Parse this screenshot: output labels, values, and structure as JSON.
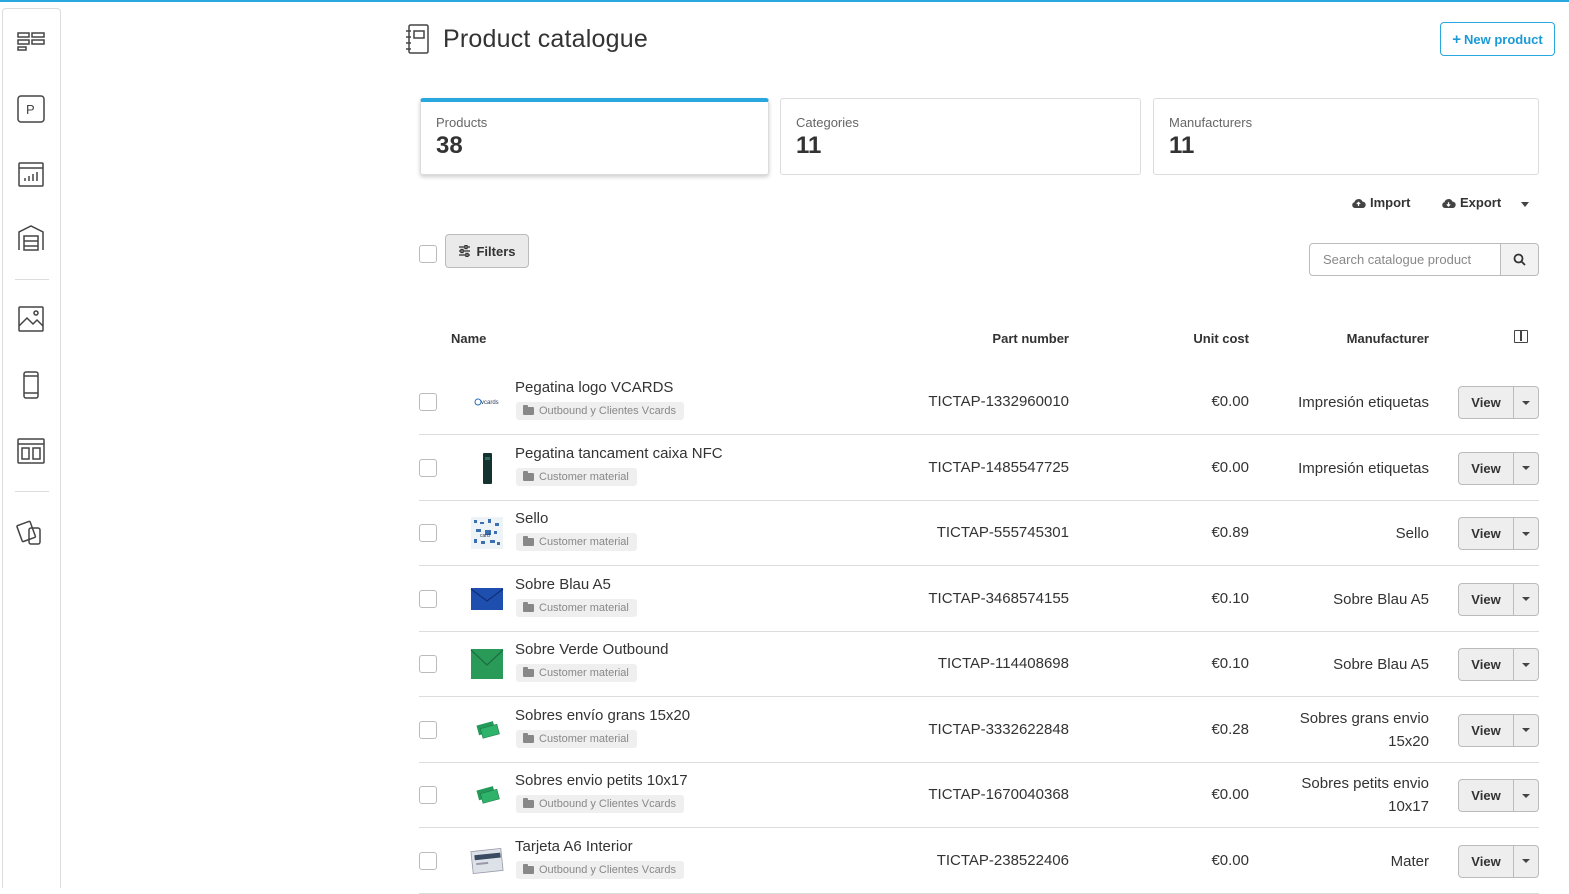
{
  "header": {
    "title": "Product catalogue",
    "new_button": "New product"
  },
  "stats": [
    {
      "label": "Products",
      "value": "38"
    },
    {
      "label": "Categories",
      "value": "11"
    },
    {
      "label": "Manufacturers",
      "value": "11"
    }
  ],
  "toolbar": {
    "import": "Import",
    "export": "Export",
    "filters": "Filters",
    "search_placeholder": "Search catalogue product"
  },
  "table": {
    "headers": {
      "name": "Name",
      "part_number": "Part number",
      "unit_cost": "Unit cost",
      "manufacturer": "Manufacturer"
    },
    "view_label": "View",
    "rows": [
      {
        "name": "Pegatina logo VCARDS",
        "tag": "Outbound y Clientes Vcards",
        "part_number": "TICTAP-1332960010",
        "unit_cost": "€0.00",
        "manufacturer": "Impresión etiquetas",
        "thumb": "vcards-logo"
      },
      {
        "name": "Pegatina tancament caixa NFC",
        "tag": "Customer material",
        "part_number": "TICTAP-1485547725",
        "unit_cost": "€0.00",
        "manufacturer": "Impresión etiquetas",
        "thumb": "dark-strip"
      },
      {
        "name": "Sello",
        "tag": "Customer material",
        "part_number": "TICTAP-555745301",
        "unit_cost": "€0.89",
        "manufacturer": "Sello",
        "thumb": "stamp-pattern"
      },
      {
        "name": "Sobre Blau A5",
        "tag": "Customer material",
        "part_number": "TICTAP-3468574155",
        "unit_cost": "€0.10",
        "manufacturer": "Sobre Blau A5",
        "thumb": "blue-envelope"
      },
      {
        "name": "Sobre Verde Outbound",
        "tag": "Customer material",
        "part_number": "TICTAP-114408698",
        "unit_cost": "€0.10",
        "manufacturer": "Sobre Blau A5",
        "thumb": "green-envelope"
      },
      {
        "name": "Sobres envío grans 15x20",
        "tag": "Customer material",
        "part_number": "TICTAP-3332622848",
        "unit_cost": "€0.28",
        "manufacturer": "Sobres grans envio 15x20",
        "thumb": "green-envelopes"
      },
      {
        "name": "Sobres envio petits 10x17",
        "tag": "Outbound y Clientes Vcards",
        "part_number": "TICTAP-1670040368",
        "unit_cost": "€0.00",
        "manufacturer": "Sobres petits envio 10x17",
        "thumb": "green-envelopes"
      },
      {
        "name": "Tarjeta A6 Interior",
        "tag": "Outbound y Clientes Vcards",
        "part_number": "TICTAP-238522406",
        "unit_cost": "€0.00",
        "manufacturer": "Mater",
        "thumb": "card"
      }
    ]
  },
  "sidebar": {
    "icons": [
      "dashboard-icon",
      "parking-icon",
      "analytics-icon",
      "warehouse-icon",
      "gallery-icon",
      "mobile-icon",
      "layout-icon",
      "devices-icon"
    ]
  },
  "colors": {
    "accent": "#29a8e0"
  }
}
